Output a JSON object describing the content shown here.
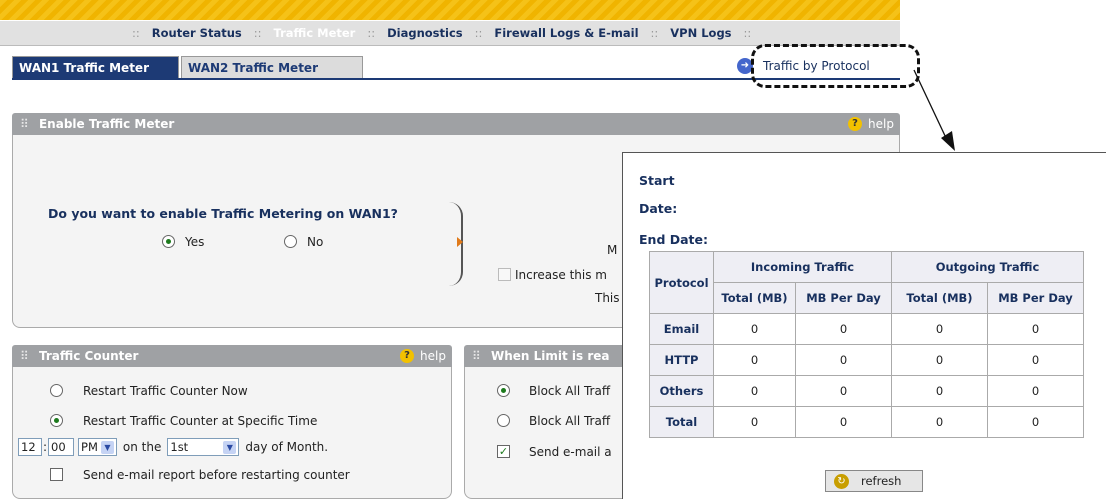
{
  "menu": {
    "items": [
      "Router Status",
      "Traffic Meter",
      "Diagnostics",
      "Firewall Logs & E-mail",
      "VPN Logs"
    ]
  },
  "tabs": [
    "WAN1 Traffic Meter",
    "WAN2 Traffic Meter"
  ],
  "traffic_by_protocol": "Traffic by Protocol",
  "enable_section": {
    "title": "Enable Traffic Meter",
    "help": "help",
    "question": "Do you want to enable Traffic Metering on WAN1?",
    "yes": "Yes",
    "no": "No",
    "partial_m": "M",
    "increase_label": "Increase this m",
    "this_label": "This"
  },
  "counter_section": {
    "title": "Traffic Counter",
    "help": "help",
    "restart_now": "Restart Traffic Counter Now",
    "restart_specific": "Restart Traffic Counter at Specific Time",
    "hour": "12",
    "minute": "00",
    "ampm": "PM",
    "on_the": "on the",
    "day": "1st",
    "day_of_month": "day of Month.",
    "send_report": "Send e-mail report before restarting counter"
  },
  "limit_section": {
    "title": "When Limit is rea",
    "block1": "Block All Traff",
    "block2": "Block All Traff",
    "send_email": "Send e-mail a"
  },
  "popout": {
    "start": "Start",
    "date": "Date:",
    "end_date": "End Date:",
    "headers": {
      "protocol": "Protocol",
      "incoming": "Incoming Traffic",
      "outgoing": "Outgoing Traffic",
      "total_mb": "Total (MB)",
      "mb_per_day": "MB Per Day"
    },
    "rows": [
      {
        "name": "Email",
        "values": [
          "0",
          "0",
          "0",
          "0"
        ]
      },
      {
        "name": "HTTP",
        "values": [
          "0",
          "0",
          "0",
          "0"
        ]
      },
      {
        "name": "Others",
        "values": [
          "0",
          "0",
          "0",
          "0"
        ]
      },
      {
        "name": "Total",
        "values": [
          "0",
          "0",
          "0",
          "0"
        ]
      }
    ],
    "refresh": "refresh"
  }
}
